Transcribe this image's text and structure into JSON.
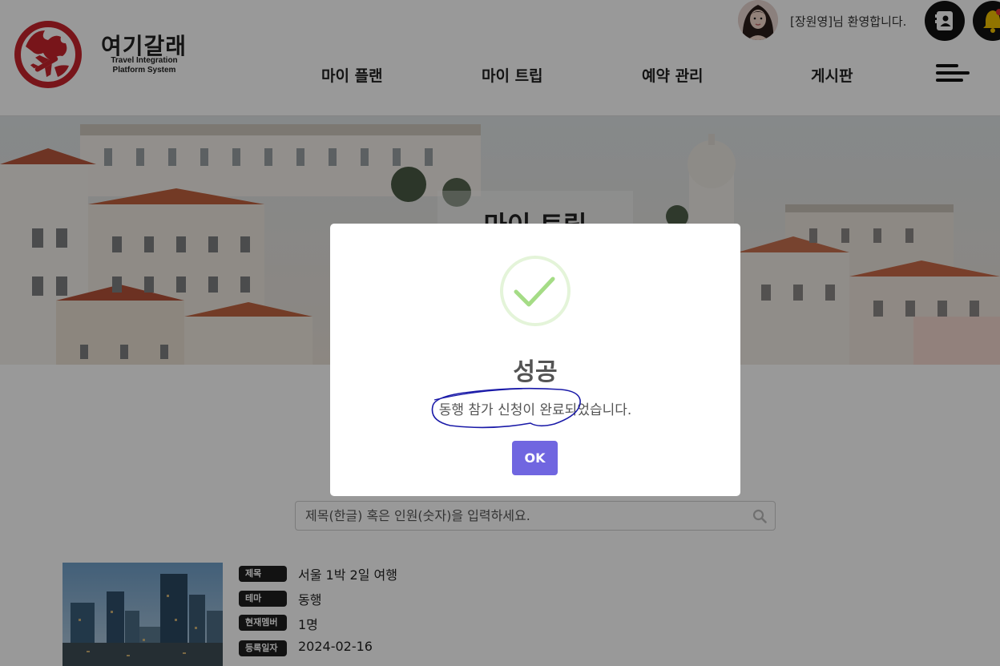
{
  "header": {
    "logo_title": "여기갈래",
    "logo_sub_line1": "Travel Integration",
    "logo_sub_line2": "Platform System",
    "welcome_text": "[장원영]님 환영합니다.",
    "nav": [
      {
        "label": "마이 플랜"
      },
      {
        "label": "마이 트립"
      },
      {
        "label": "예약 관리"
      },
      {
        "label": "게시판"
      }
    ],
    "icons": {
      "user_button": "contact-card-icon",
      "bell_button": "bell-icon",
      "menu": "hamburger-menu-icon"
    }
  },
  "hero": {
    "title": "마이 트립"
  },
  "search": {
    "placeholder": "제목(한글) 혹은 인원(숫자)을 입력하세요."
  },
  "trip": {
    "fields": [
      {
        "label": "제목",
        "value": "서울 1박 2일 여행"
      },
      {
        "label": "테마",
        "value": "동행"
      },
      {
        "label": "현재멤버",
        "value": "1명"
      },
      {
        "label": "등록일자",
        "value": "2024-02-16"
      }
    ]
  },
  "modal": {
    "title": "성공",
    "message": "동행 참가 신청이 완료되었습니다.",
    "ok_label": "OK",
    "icon": "success-check-icon"
  },
  "colors": {
    "brand_red": "#c8232c",
    "ok_button": "#7066e0",
    "success_green": "#a5dc86",
    "annotation_blue": "#1a1aa8"
  }
}
